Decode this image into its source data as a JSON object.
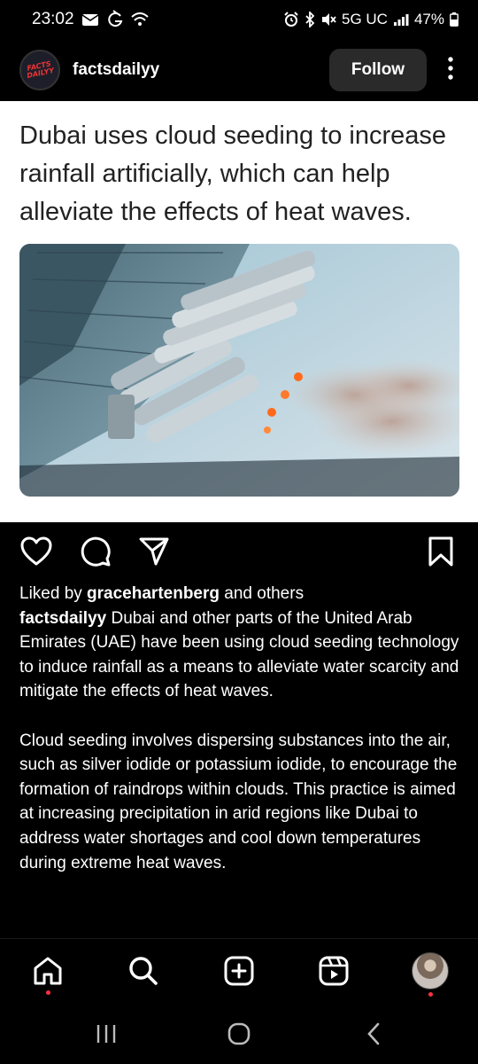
{
  "status_bar": {
    "time": "23:02",
    "network": "5G UC",
    "battery": "47%"
  },
  "header": {
    "username": "factsdailyy",
    "follow_label": "Follow",
    "avatar_text": "FACTS DAILYY"
  },
  "post": {
    "title": "Dubai uses cloud seeding to increase rainfall artificially, which can help alleviate the effects of heat waves."
  },
  "likes": {
    "prefix": "Liked by ",
    "user": "gracehartenberg",
    "suffix": " and others"
  },
  "caption": {
    "username": "factsdailyy",
    "paragraph1": " Dubai and other parts of the United Arab Emirates (UAE) have been using cloud seeding technology to induce rainfall as a means to alleviate water scarcity and mitigate the effects of heat waves.",
    "paragraph2": "Cloud seeding involves dispersing substances into the air, such as silver iodide or potassium iodide, to encourage the formation of raindrops within clouds. This practice is aimed at increasing precipitation in arid regions like Dubai to address water shortages and cool down temperatures during extreme heat waves."
  },
  "icons": {
    "like": "heart-icon",
    "comment": "comment-icon",
    "share": "send-icon",
    "save": "bookmark-icon",
    "home": "home-icon",
    "search": "search-icon",
    "create": "plus-square-icon",
    "reels": "reels-icon"
  },
  "colors": {
    "background": "#000000",
    "card": "#ffffff",
    "notification_dot": "#ff3040",
    "follow_button": "#2a2a2a"
  }
}
